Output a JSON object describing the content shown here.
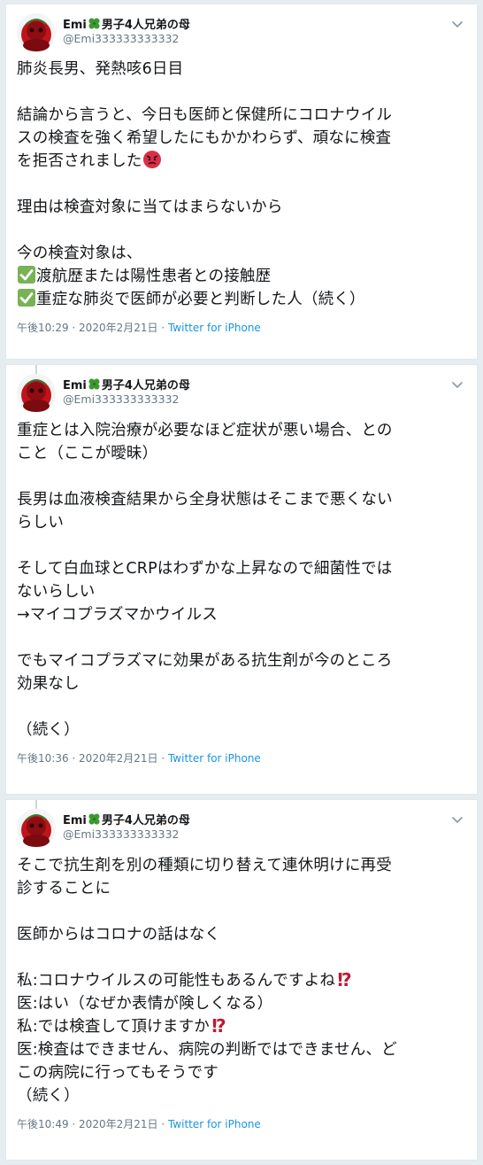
{
  "author": {
    "display_name": "Emi",
    "name_suffix": "男子4人兄弟の母",
    "handle": "@Emi333333333332",
    "clover_icon": "four-leaf-clover-icon",
    "avatar_icon": "red-character-avatar"
  },
  "tweets": [
    {
      "lines": [
        "肺炎長男、発熱咳6日目",
        "",
        "結論から言うと、今日も医師と保健所にコロナウイル",
        "スの検査を強く希望したにもかかわらず、頑なに検査",
        "を拒否されました",
        "",
        "理由は検査対象に当てはまらないから",
        "",
        "今の検査対象は、",
        "渡航歴または陽性患者との接触歴",
        "重症な肺炎で医師が必要と判断した人（続く）"
      ],
      "time": "午後10:29",
      "date": "2020年2月21日",
      "source": "Twitter for iPhone"
    },
    {
      "lines": [
        "重症とは入院治療が必要なほど症状が悪い場合、との",
        "こと（ここが曖昧）",
        "",
        "長男は血液検査結果から全身状態はそこまで悪くない",
        "らしい",
        "",
        "そして白血球とCRPはわずかな上昇なので細菌性では",
        "ないらしい",
        "→マイコプラズマかウイルス",
        "",
        "でもマイコプラズマに効果がある抗生剤が今のところ",
        "効果なし",
        "",
        "（続く）"
      ],
      "time": "午後10:36",
      "date": "2020年2月21日",
      "source": "Twitter for iPhone"
    },
    {
      "lines": [
        "そこで抗生剤を別の種類に切り替えて連休明けに再受",
        "診することに",
        "",
        "医師からはコロナの話はなく",
        "",
        "私:コロナウイルスの可能性もあるんですよね",
        "医:はい（なぜか表情が険しくなる）",
        "私:では検査して頂けますか",
        "医:検査はできません、病院の判断ではできません、ど",
        "この病院に行ってもそうです",
        "（続く）"
      ],
      "time": "午後10:49",
      "date": "2020年2月21日",
      "source": "Twitter for iPhone"
    }
  ],
  "meta_separator": " · ",
  "icons": {
    "angry": "angry-face-icon",
    "check": "check-mark-button-icon",
    "interrobang": "exclamation-question-mark-icon",
    "caret": "chevron-down-icon"
  },
  "colors": {
    "background": "#e6ecf0",
    "card": "#ffffff",
    "text": "#14171a",
    "secondary": "#657786",
    "link": "#1b95e0",
    "check_green": "#77b255",
    "angry_red": "#da2f47",
    "interrobang_red": "#be1931"
  }
}
